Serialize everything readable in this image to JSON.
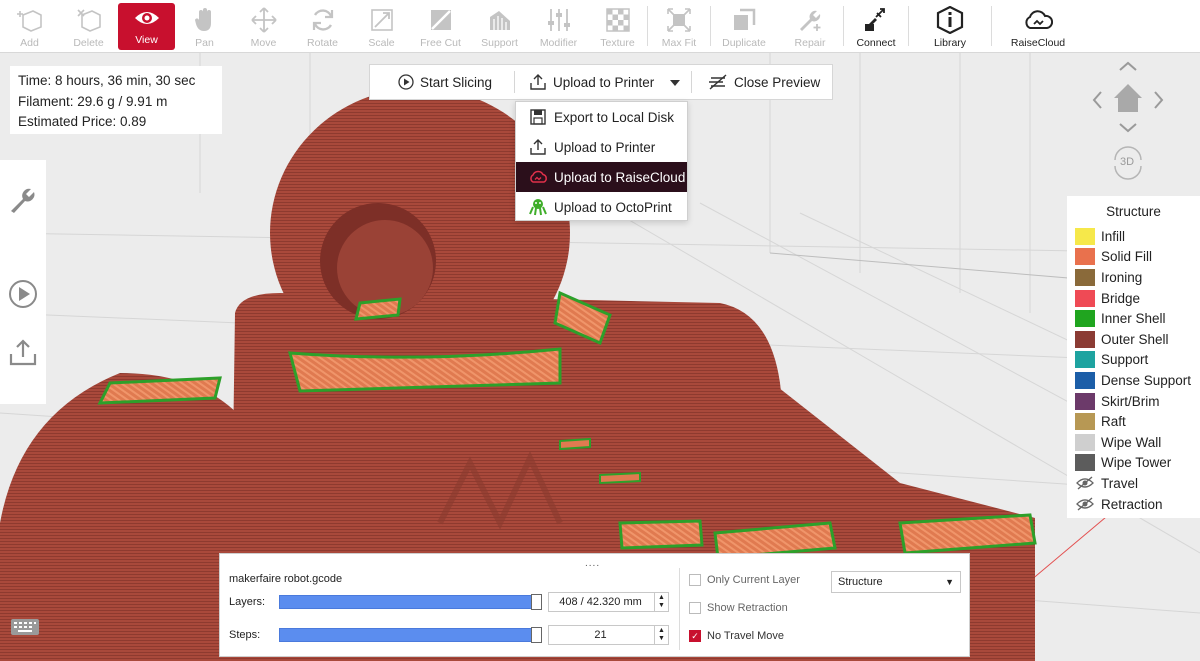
{
  "toolbar": {
    "add": "Add",
    "delete": "Delete",
    "view": "View",
    "pan": "Pan",
    "move": "Move",
    "rotate": "Rotate",
    "scale": "Scale",
    "free_cut": "Free Cut",
    "support": "Support",
    "modifier": "Modifier",
    "texture": "Texture",
    "max_fit": "Max Fit",
    "duplicate": "Duplicate",
    "repair": "Repair",
    "connect": "Connect",
    "library": "Library",
    "raisecloud": "RaiseCloud"
  },
  "info": {
    "time": "Time: 8 hours, 36 min, 30 sec",
    "filament": "Filament: 29.6 g / 9.91 m",
    "price": "Estimated Price: 0.89"
  },
  "actions": {
    "start_slicing": "Start Slicing",
    "upload_to_printer": "Upload to Printer",
    "close_preview": "Close Preview"
  },
  "dropdown": {
    "items": [
      "Export to Local Disk",
      "Upload to Printer",
      "Upload to RaiseCloud",
      "Upload to OctoPrint"
    ],
    "highlighted": "Upload to RaiseCloud"
  },
  "navcube": {
    "label_3d": "3D"
  },
  "legend": {
    "title": "Structure",
    "items": [
      {
        "label": "Infill",
        "color": "#f6e84a"
      },
      {
        "label": "Solid Fill",
        "color": "#e9714d"
      },
      {
        "label": "Ironing",
        "color": "#8a6a3a"
      },
      {
        "label": "Bridge",
        "color": "#ef4a55"
      },
      {
        "label": "Inner Shell",
        "color": "#20a51f"
      },
      {
        "label": "Outer Shell",
        "color": "#8b3b34"
      },
      {
        "label": "Support",
        "color": "#1ea3a0"
      },
      {
        "label": "Dense Support",
        "color": "#1c5ea8"
      },
      {
        "label": "Skirt/Brim",
        "color": "#6c3a6a"
      },
      {
        "label": "Raft",
        "color": "#b79854"
      },
      {
        "label": "Wipe Wall",
        "color": "#cfcfcf"
      },
      {
        "label": "Wipe Tower",
        "color": "#5c5c5c"
      },
      {
        "label": "Travel",
        "icon": "eye-hidden-icon"
      },
      {
        "label": "Retraction",
        "icon": "eye-hidden-icon"
      }
    ]
  },
  "panel": {
    "grip": "....",
    "filename": "makerfaire robot.gcode",
    "layers_label": "Layers:",
    "layers_value": "408 / 42.320 mm",
    "layers_progress": 1.0,
    "steps_label": "Steps:",
    "steps_value": "21",
    "steps_progress": 1.0,
    "only_current_layer": "Only Current Layer",
    "only_current_layer_checked": false,
    "show_retraction": "Show Retraction",
    "show_retraction_checked": false,
    "no_travel_move": "No Travel Move",
    "no_travel_move_checked": true,
    "view_mode": "Structure"
  },
  "colors": {
    "accent": "#c8102e",
    "model": "#a84a3c",
    "slider": "#5b8def"
  }
}
